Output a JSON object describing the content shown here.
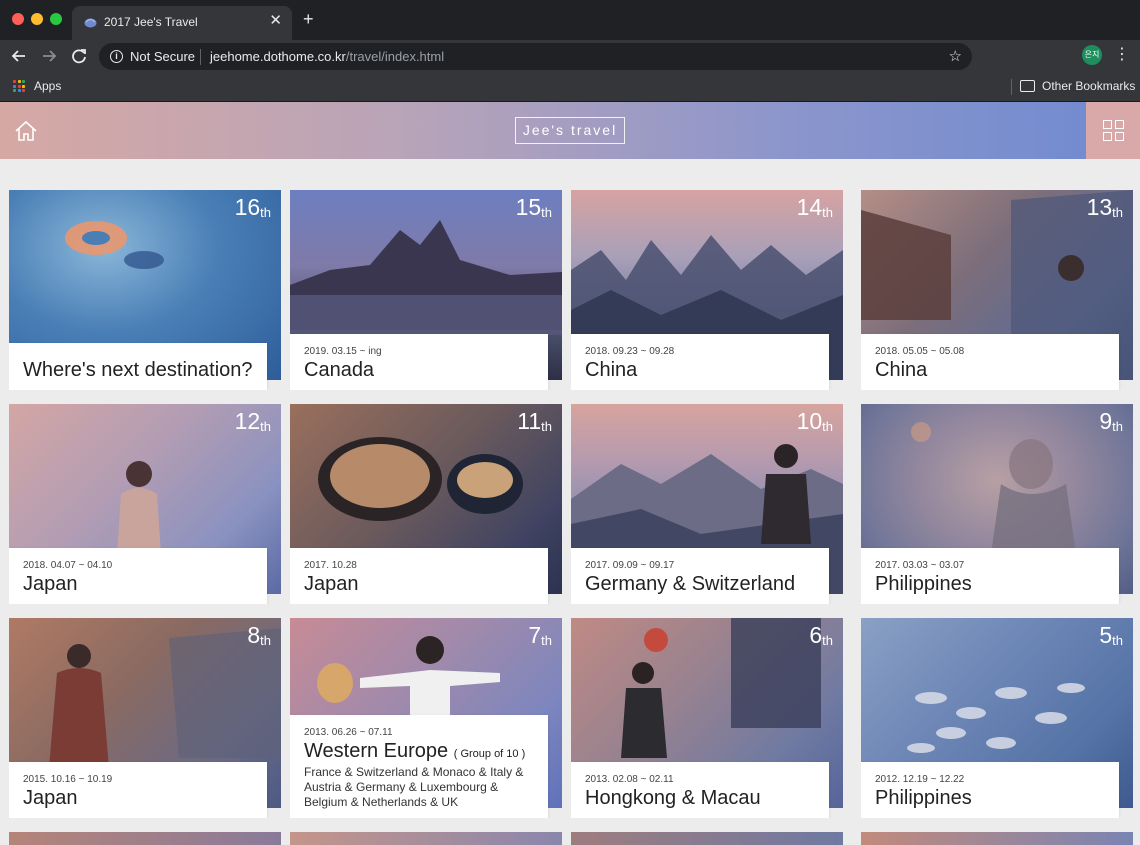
{
  "browser": {
    "tab_title": "2017 Jee's Travel",
    "close_glyph": "✕",
    "new_tab_glyph": "+",
    "security_label": "Not Secure",
    "url_host": "jeehome.dothome.co.kr",
    "url_path": "/travel/index.html",
    "profile_initials": "은지",
    "bookmarks": {
      "apps_label": "Apps",
      "other_label": "Other Bookmarks"
    }
  },
  "site": {
    "title": "Jee's travel"
  },
  "cards": [
    {
      "ordinal": "16",
      "suffix": "th",
      "date": "",
      "place": "Where's next destination?",
      "group": "",
      "extra": ""
    },
    {
      "ordinal": "15",
      "suffix": "th",
      "date": "2019. 03.15 ~ ing",
      "place": "Canada",
      "group": "",
      "extra": ""
    },
    {
      "ordinal": "14",
      "suffix": "th",
      "date": "2018. 09.23 ~ 09.28",
      "place": "China",
      "group": "",
      "extra": ""
    },
    {
      "ordinal": "13",
      "suffix": "th",
      "date": "2018. 05.05 ~ 05.08",
      "place": "China",
      "group": "",
      "extra": ""
    },
    {
      "ordinal": "12",
      "suffix": "th",
      "date": "2018. 04.07 ~ 04.10",
      "place": "Japan",
      "group": "",
      "extra": ""
    },
    {
      "ordinal": "11",
      "suffix": "th",
      "date": "2017. 10.28",
      "place": "Japan",
      "group": "",
      "extra": ""
    },
    {
      "ordinal": "10",
      "suffix": "th",
      "date": "2017. 09.09 ~ 09.17",
      "place": "Germany & Switzerland",
      "group": "",
      "extra": ""
    },
    {
      "ordinal": "9",
      "suffix": "th",
      "date": "2017. 03.03 ~ 03.07",
      "place": "Philippines",
      "group": "",
      "extra": ""
    },
    {
      "ordinal": "8",
      "suffix": "th",
      "date": "2015. 10.16 ~ 10.19",
      "place": "Japan",
      "group": "",
      "extra": ""
    },
    {
      "ordinal": "7",
      "suffix": "th",
      "date": "2013. 06.26 ~ 07.11",
      "place": "Western Europe",
      "group": "( Group of 10 )",
      "extra": "France & Switzerland & Monaco & Italy & Austria & Germany & Luxembourg & Belgium & Netherlands & UK"
    },
    {
      "ordinal": "6",
      "suffix": "th",
      "date": "2013. 02.08 ~ 02.11",
      "place": "Hongkong & Macau",
      "group": "",
      "extra": ""
    },
    {
      "ordinal": "5",
      "suffix": "th",
      "date": "2012. 12.19 ~ 12.22",
      "place": "Philippines",
      "group": "",
      "extra": ""
    }
  ],
  "colors": {
    "header_start": "#d6a8a4",
    "header_end": "#6f8ad0",
    "grid_button": "#d9a8a8",
    "page_bg": "#ececec"
  }
}
